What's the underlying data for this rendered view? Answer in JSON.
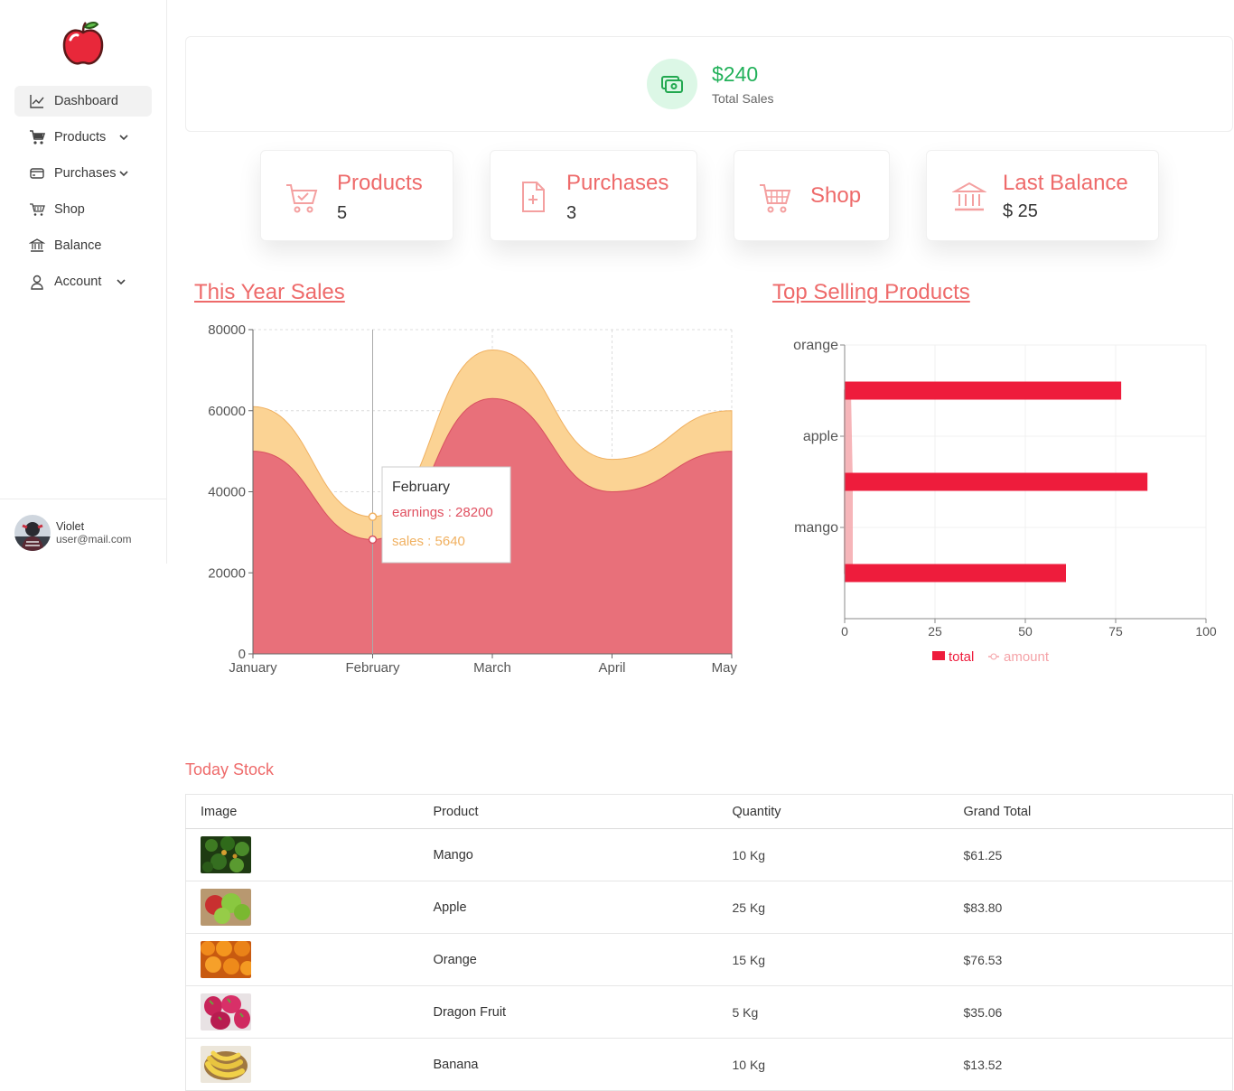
{
  "sidebar": {
    "items": [
      {
        "label": "Dashboard",
        "icon": "chart-line-icon",
        "active": true,
        "has_submenu": false
      },
      {
        "label": "Products",
        "icon": "cart-icon",
        "active": false,
        "has_submenu": true
      },
      {
        "label": "Purchases",
        "icon": "credit-card-icon",
        "active": false,
        "has_submenu": true
      },
      {
        "label": "Shop",
        "icon": "basket-icon",
        "active": false,
        "has_submenu": false
      },
      {
        "label": "Balance",
        "icon": "bank-icon",
        "active": false,
        "has_submenu": false
      },
      {
        "label": "Account",
        "icon": "user-icon",
        "active": false,
        "has_submenu": true
      }
    ],
    "user": {
      "name": "Violet",
      "email": "user@mail.com"
    }
  },
  "total_sales": {
    "value": "$240",
    "label": "Total Sales",
    "icon": "money-icon"
  },
  "stats": [
    {
      "title": "Products",
      "value": "5",
      "icon": "cart-check-icon"
    },
    {
      "title": "Purchases",
      "value": "3",
      "icon": "file-plus-icon"
    },
    {
      "title": "Shop",
      "value": "",
      "icon": "basket-icon"
    },
    {
      "title": "Last Balance",
      "value": "$ 25",
      "icon": "bank-icon"
    }
  ],
  "sales_section": {
    "title": "This Year Sales"
  },
  "top_section": {
    "title": "Top Selling Products"
  },
  "chart_data": [
    {
      "type": "area",
      "title": "This Year Sales",
      "categories": [
        "January",
        "February",
        "March",
        "April",
        "May"
      ],
      "series": [
        {
          "name": "earnings",
          "values": [
            50000,
            28200,
            63000,
            40000,
            50000
          ],
          "color": "#e8707a"
        },
        {
          "name": "sales",
          "values": [
            11000,
            5640,
            12000,
            8000,
            10000
          ],
          "color": "#fbd394"
        }
      ],
      "stacked": true,
      "ylim": [
        0,
        80000
      ],
      "yticks": [
        0,
        20000,
        40000,
        60000,
        80000
      ],
      "grid": true,
      "tooltip": {
        "title": "February",
        "lines": [
          "earnings : 28200",
          "sales : 5640"
        ]
      }
    },
    {
      "type": "bar",
      "orientation": "horizontal",
      "title": "Top Selling Products",
      "categories": [
        "orange",
        "apple",
        "mango"
      ],
      "series": [
        {
          "name": "total",
          "values": [
            76.53,
            83.8,
            61.25
          ],
          "color": "#ee1c3c"
        },
        {
          "name": "amount",
          "values": [
            1.5,
            2,
            2
          ],
          "color": "#f5a3a8"
        }
      ],
      "xlim": [
        0,
        100
      ],
      "xticks": [
        0,
        25,
        50,
        75,
        100
      ],
      "grid": true,
      "legend": "bottom"
    }
  ],
  "stock": {
    "title": "Today Stock",
    "headers": [
      "Image",
      "Product",
      "Quantity",
      "Grand Total"
    ],
    "rows": [
      {
        "product": "Mango",
        "quantity": "10 Kg",
        "total": "$61.25",
        "color": "#2f5a1c"
      },
      {
        "product": "Apple",
        "quantity": "25 Kg",
        "total": "$83.80",
        "color": "#7fbf3a"
      },
      {
        "product": "Orange",
        "quantity": "15 Kg",
        "total": "$76.53",
        "color": "#f08a1c"
      },
      {
        "product": "Dragon Fruit",
        "quantity": "5 Kg",
        "total": "$35.06",
        "color": "#c8245a"
      },
      {
        "product": "Banana",
        "quantity": "10 Kg",
        "total": "$13.52",
        "color": "#e8c860"
      }
    ]
  }
}
